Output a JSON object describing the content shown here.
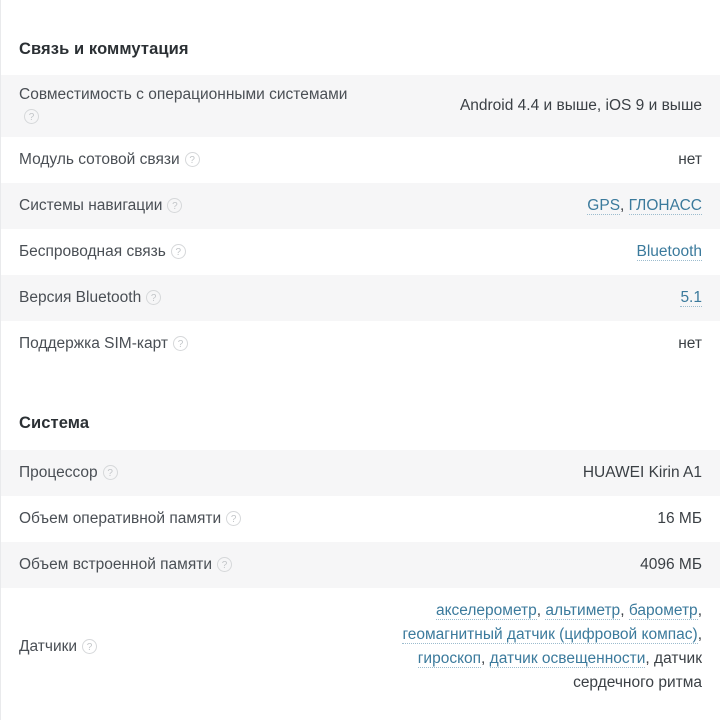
{
  "colors": {
    "link": "#3b7a9c",
    "link_underline": "#9cbcce",
    "row_alt_bg": "#f6f6f7",
    "row_bg": "#ffffff",
    "label_text": "#4a4f55",
    "value_text": "#3b4045",
    "heading_text": "#2b3034"
  },
  "help_icon_glyph": "?",
  "sections": [
    {
      "title": "Связь и коммутация",
      "rows": [
        {
          "label": "Совместимость с операционными системами",
          "value": "Android 4.4 и выше, iOS 9 и выше",
          "has_help": true,
          "is_link": false
        },
        {
          "label": "Модуль сотовой связи",
          "value": "нет",
          "has_help": true,
          "is_link": false
        },
        {
          "label": "Системы навигации",
          "value": "GPS, ГЛОНАСС",
          "has_help": true,
          "is_link": true,
          "link_parts": [
            {
              "text": "GPS",
              "link": true
            },
            {
              "text": ", ",
              "link": false
            },
            {
              "text": "ГЛОНАСС",
              "link": true
            }
          ]
        },
        {
          "label": "Беспроводная связь",
          "value": "Bluetooth",
          "has_help": true,
          "is_link": true,
          "link_parts": [
            {
              "text": "Bluetooth",
              "link": true
            }
          ]
        },
        {
          "label": "Версия Bluetooth",
          "value": "5.1",
          "has_help": true,
          "is_link": true,
          "link_parts": [
            {
              "text": "5.1",
              "link": true
            }
          ]
        },
        {
          "label": "Поддержка SIM-карт",
          "value": "нет",
          "has_help": true,
          "is_link": false
        }
      ]
    },
    {
      "title": "Система",
      "rows": [
        {
          "label": "Процессор",
          "value": "HUAWEI Kirin A1",
          "has_help": true,
          "is_link": false
        },
        {
          "label": "Объем оперативной памяти",
          "value": "16 МБ",
          "has_help": true,
          "is_link": false
        },
        {
          "label": "Объем встроенной памяти",
          "value": "4096 МБ",
          "has_help": true,
          "is_link": false
        },
        {
          "label": "Датчики",
          "value": "акселерометр, альтиметр, барометр, геомагнитный датчик (цифровой компас), гироскоп, датчик освещенности, датчик сердечного ритма",
          "has_help": true,
          "is_link": true,
          "link_parts": [
            {
              "text": "акселерометр",
              "link": true
            },
            {
              "text": ", ",
              "link": false
            },
            {
              "text": "альтиметр",
              "link": true
            },
            {
              "text": ", ",
              "link": false
            },
            {
              "text": "барометр",
              "link": true
            },
            {
              "text": ", ",
              "link": false
            },
            {
              "text": "геомагнитный датчик (цифровой компас)",
              "link": true
            },
            {
              "text": ", ",
              "link": false
            },
            {
              "text": "гироскоп",
              "link": true
            },
            {
              "text": ", ",
              "link": false
            },
            {
              "text": "датчик освещенности",
              "link": true
            },
            {
              "text": ", ",
              "link": false
            },
            {
              "text": "датчик сердечного ритма",
              "link": false
            }
          ]
        }
      ]
    }
  ]
}
